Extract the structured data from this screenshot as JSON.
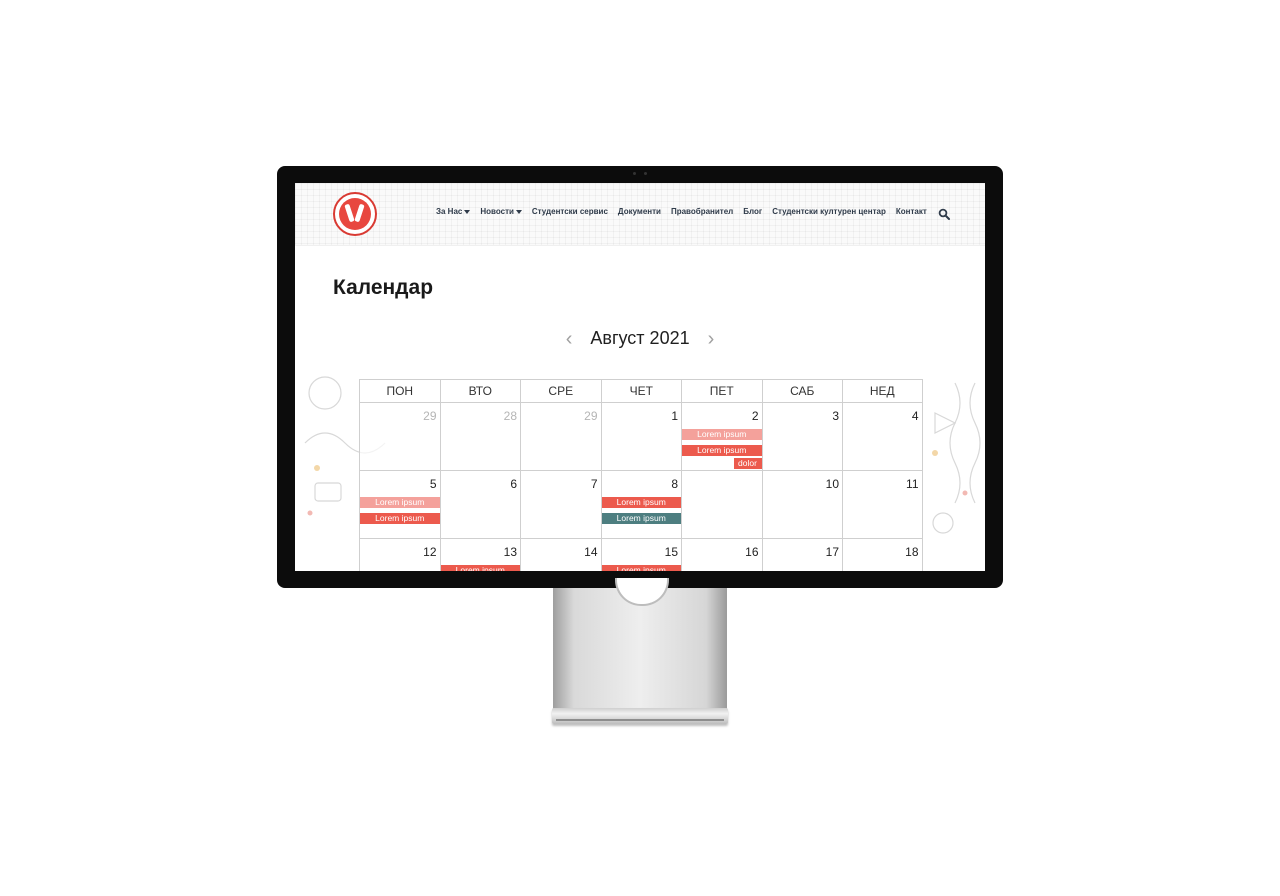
{
  "header": {
    "logo": "union-emblem",
    "nav": [
      {
        "label": "За Нас",
        "dropdown": true
      },
      {
        "label": "Новости",
        "dropdown": true
      },
      {
        "label": "Студентски сервис",
        "dropdown": false
      },
      {
        "label": "Документи",
        "dropdown": false
      },
      {
        "label": "Правобранител",
        "dropdown": false
      },
      {
        "label": "Блог",
        "dropdown": false
      },
      {
        "label": "Студентски културен центар",
        "dropdown": false
      },
      {
        "label": "Контакт",
        "dropdown": false
      }
    ],
    "search_icon": "search-icon"
  },
  "page": {
    "title": "Календар",
    "month_label": "Август 2021",
    "prev_icon": "chevron-left-icon",
    "next_icon": "chevron-right-icon"
  },
  "calendar": {
    "weekdays": [
      "ПОН",
      "ВТО",
      "СРЕ",
      "ЧЕТ",
      "ПЕТ",
      "САБ",
      "НЕД"
    ],
    "weeks": [
      [
        {
          "day": "29",
          "muted": true
        },
        {
          "day": "28",
          "muted": true
        },
        {
          "day": "29",
          "muted": true
        },
        {
          "day": "1"
        },
        {
          "day": "2",
          "events": [
            {
              "label": "Lorem ipsum",
              "style": "light"
            },
            {
              "label": "Lorem ipsum",
              "style": "red"
            },
            {
              "label": "dolor",
              "style": "red"
            }
          ]
        },
        {
          "day": "3"
        },
        {
          "day": "4"
        }
      ],
      [
        {
          "day": "5",
          "events": [
            {
              "label": "Lorem ipsum",
              "style": "light"
            },
            {
              "label": "Lorem ipsum",
              "style": "red"
            }
          ]
        },
        {
          "day": "6"
        },
        {
          "day": "7"
        },
        {
          "day": "8",
          "events": [
            {
              "label": "Lorem ipsum",
              "style": "red"
            },
            {
              "label": "Lorem ipsum",
              "style": "teal"
            }
          ]
        },
        {
          "day": ""
        },
        {
          "day": "10"
        },
        {
          "day": "11"
        }
      ],
      [
        {
          "day": "12"
        },
        {
          "day": "13",
          "events": [
            {
              "label": "Lorem ipsum",
              "style": "red"
            }
          ]
        },
        {
          "day": "14"
        },
        {
          "day": "15",
          "events": [
            {
              "label": "Lorem ipsum",
              "style": "red"
            }
          ]
        },
        {
          "day": "16"
        },
        {
          "day": "17"
        },
        {
          "day": "18"
        }
      ]
    ]
  },
  "colors": {
    "accent": "#ec5a4d",
    "accent_light": "#f4a19b",
    "teal": "#4d7e80",
    "nav_text": "#2f3b4a"
  }
}
